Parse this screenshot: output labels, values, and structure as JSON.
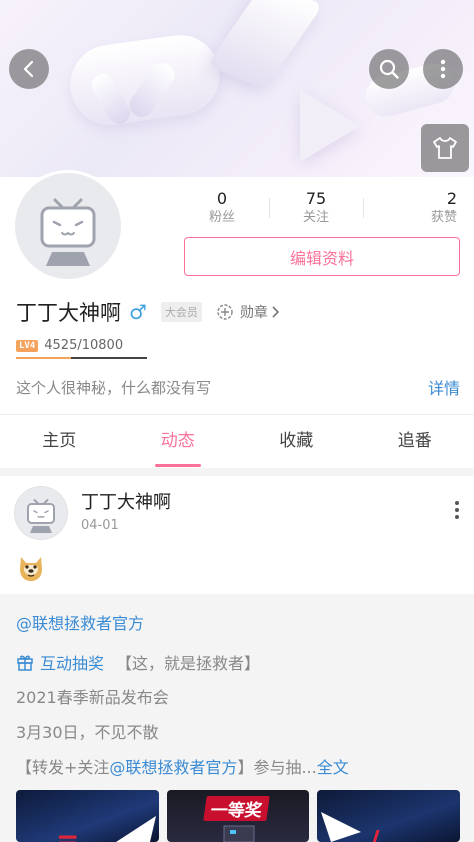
{
  "profile": {
    "stats": [
      {
        "value": "0",
        "label": "粉丝"
      },
      {
        "value": "75",
        "label": "关注"
      },
      {
        "value": "2",
        "label": "获赞"
      }
    ],
    "edit_label": "编辑资料",
    "name": "丁丁大神啊",
    "gender_symbol": "♂",
    "vip_label": "大会员",
    "medal_label": "勋章",
    "level_badge": "LV4",
    "exp_text": "4525/10800",
    "exp_fraction": 0.419,
    "signature": "这个人很神秘，什么都没有写",
    "detail_link": "详情"
  },
  "tabs": [
    {
      "label": "主页",
      "active": false
    },
    {
      "label": "动态",
      "active": true
    },
    {
      "label": "收藏",
      "active": false
    },
    {
      "label": "追番",
      "active": false
    }
  ],
  "post": {
    "author": "丁丁大神啊",
    "date": "04-01",
    "emoji": "doge-emoji",
    "repost": {
      "mention": "@联想拯救者官方",
      "lottery_label": "互动抽奖",
      "lottery_text": "【这，就是拯救者】",
      "line3": "2021春季新品发布会",
      "line4": "3月30日，不见不散",
      "line5_prefix": "【转发+关注",
      "line5_mention": "@联想拯救者官方",
      "line5_suffix": "】参与抽...",
      "full_text_link": "全文",
      "thumb2_text": "一等奖"
    }
  },
  "colors": {
    "accent": "#fb7299",
    "link": "#3b8bd4",
    "level": "#f5a25d"
  },
  "icons": [
    "back-arrow-icon",
    "search-icon",
    "more-vertical-icon",
    "tshirt-icon",
    "tv-mascot-icon",
    "medal-icon",
    "chevron-right-icon",
    "gift-icon"
  ]
}
